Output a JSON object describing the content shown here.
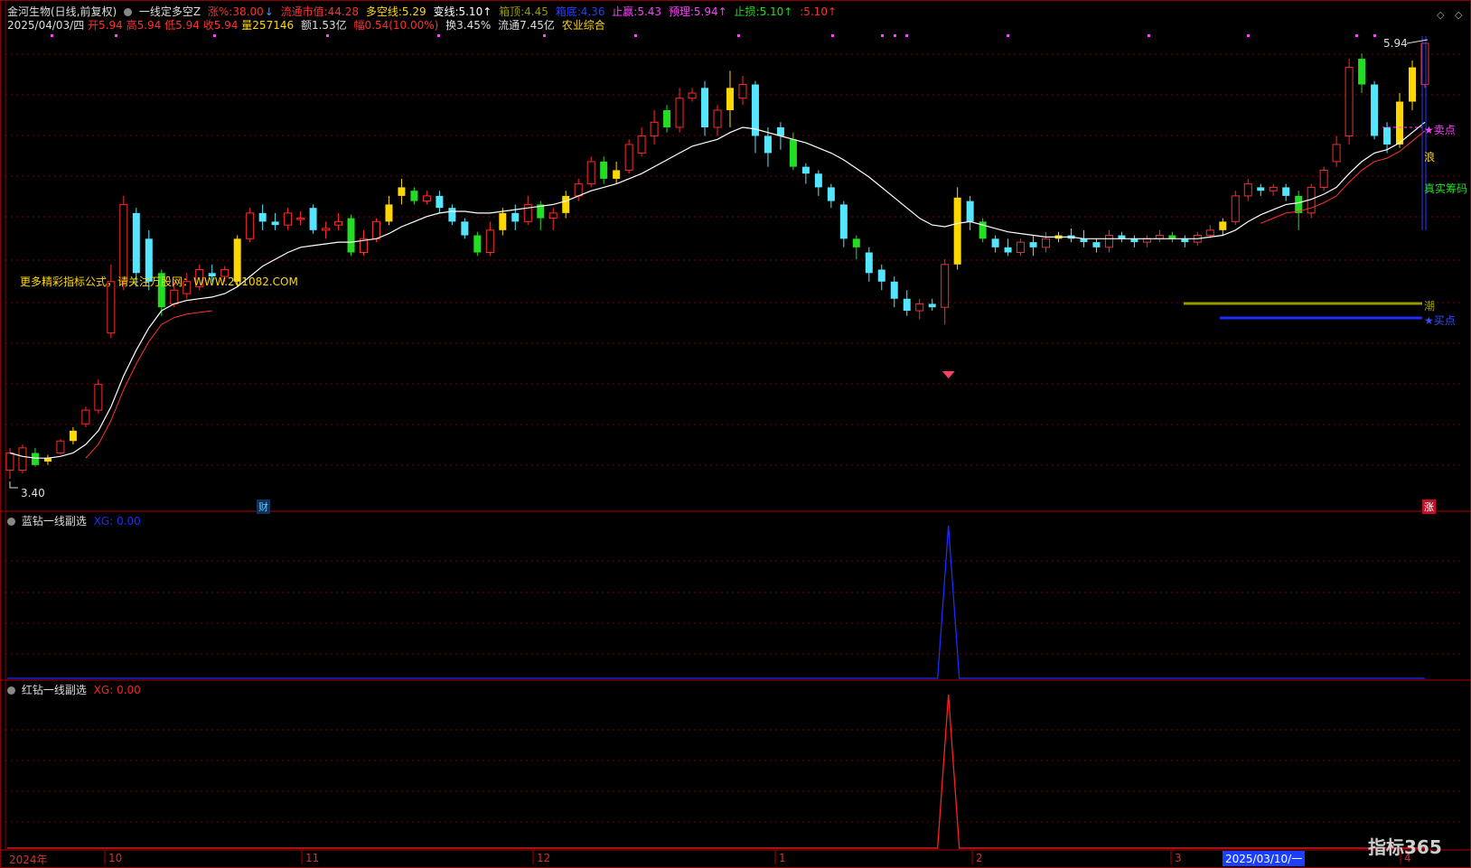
{
  "header": {
    "stock": "金河生物(日线,前复权)",
    "formula": "一线定多空Z",
    "chg_label": "涨%:",
    "chg_value": "38.00",
    "chg_arrow": "↓",
    "mv_label": "流通市值:",
    "mv_value": "44.28",
    "dk_label": "多空线:",
    "dk_value": "5.29",
    "bx_label": "变线:",
    "bx_value": "5.10↑",
    "xd_label": "箱顶:",
    "xd_value": "4.45",
    "xdi_label": "箱底:",
    "xdi_value": "4.36",
    "zy_label": "止赢:",
    "zy_value": "5.43",
    "yl_label": "预理:",
    "yl_value": "5.94↑",
    "zs_label": "止损:",
    "zs_value": "5.10↑",
    "extra": ":5.10↑"
  },
  "line2": {
    "date": "2025/04/03/四",
    "open": "开5.94",
    "high": "高5.94",
    "low": "低5.94",
    "close": "收5.94",
    "vol": "量257146",
    "amt": "额1.53亿",
    "range": "幅0.54(10.00%)",
    "turnover": "换3.45%",
    "float": "流通7.45亿",
    "industry": "农业综合"
  },
  "ad_text": "更多精彩指标公式，请关注万股网：WWW.201082.COM",
  "markers": {
    "fin": "财",
    "zhang": "涨",
    "sell": "★卖点",
    "buy": "★买点",
    "lang": "浪",
    "real": "真实筹码",
    "chao": "潮",
    "price_high": "5.94",
    "price_low": "3.40"
  },
  "indicators": {
    "blue": {
      "name": "蓝钻一线副选",
      "label": "XG:",
      "value": "0.00",
      "color": "#1a2cff"
    },
    "red": {
      "name": "红钻一线副选",
      "label": "XG:",
      "value": "0.00",
      "color": "#ff2020"
    }
  },
  "x_axis": {
    "labels": [
      "2024年",
      "10",
      "11",
      "12",
      "1",
      "2",
      "3",
      "4"
    ],
    "selected_date": "2025/03/10/一"
  },
  "logo": "指标365",
  "colors": {
    "up": "#ff2a2a",
    "down_cyan": "#55e6ff",
    "green": "#22dd22",
    "yellow": "#ffd700",
    "ma": "#ffffff",
    "grid": "#7a0000"
  },
  "chart_data": {
    "type": "candlestick",
    "ohlc": [
      [
        3.45,
        3.55,
        3.4,
        3.58
      ],
      [
        3.45,
        3.58,
        3.43,
        3.6
      ],
      [
        3.55,
        3.48,
        3.47,
        3.58
      ],
      [
        3.5,
        3.52,
        3.48,
        3.54
      ],
      [
        3.55,
        3.62,
        3.54,
        3.63
      ],
      [
        3.62,
        3.68,
        3.6,
        3.7
      ],
      [
        3.72,
        3.8,
        3.7,
        3.82
      ],
      [
        3.8,
        3.95,
        3.78,
        3.98
      ],
      [
        4.25,
        4.55,
        4.22,
        4.65
      ],
      [
        4.55,
        5.0,
        4.5,
        5.05
      ],
      [
        4.95,
        4.6,
        4.52,
        4.98
      ],
      [
        4.8,
        4.55,
        4.5,
        4.85
      ],
      [
        4.6,
        4.4,
        4.35,
        4.62
      ],
      [
        4.42,
        4.5,
        4.4,
        4.55
      ],
      [
        4.48,
        4.55,
        4.45,
        4.6
      ],
      [
        4.52,
        4.62,
        4.5,
        4.65
      ],
      [
        4.6,
        4.58,
        4.55,
        4.65
      ],
      [
        4.58,
        4.62,
        4.55,
        4.64
      ],
      [
        4.55,
        4.8,
        4.52,
        4.82
      ],
      [
        4.8,
        4.95,
        4.78,
        4.98
      ],
      [
        4.95,
        4.9,
        4.85,
        5.0
      ],
      [
        4.9,
        4.88,
        4.85,
        4.95
      ],
      [
        4.88,
        4.95,
        4.85,
        4.98
      ],
      [
        4.92,
        4.92,
        4.88,
        4.96
      ],
      [
        4.98,
        4.85,
        4.83,
        5.0
      ],
      [
        4.85,
        4.86,
        4.8,
        4.9
      ],
      [
        4.88,
        4.9,
        4.85,
        4.95
      ],
      [
        4.92,
        4.72,
        4.7,
        4.94
      ],
      [
        4.72,
        4.8,
        4.7,
        4.85
      ],
      [
        4.8,
        4.9,
        4.78,
        4.92
      ],
      [
        4.9,
        5.0,
        4.88,
        5.05
      ],
      [
        5.05,
        5.1,
        5.0,
        5.15
      ],
      [
        5.08,
        5.02,
        5.0,
        5.1
      ],
      [
        5.02,
        5.05,
        5.0,
        5.08
      ],
      [
        5.05,
        4.98,
        4.95,
        5.08
      ],
      [
        4.98,
        4.9,
        4.88,
        5.0
      ],
      [
        4.9,
        4.82,
        4.8,
        4.92
      ],
      [
        4.82,
        4.72,
        4.7,
        4.84
      ],
      [
        4.72,
        4.85,
        4.7,
        4.9
      ],
      [
        4.85,
        4.95,
        4.82,
        4.98
      ],
      [
        4.95,
        4.9,
        4.85,
        5.0
      ],
      [
        4.9,
        5.0,
        4.88,
        5.05
      ],
      [
        5.0,
        4.92,
        4.85,
        5.02
      ],
      [
        4.92,
        4.95,
        4.85,
        4.98
      ],
      [
        4.95,
        5.05,
        4.92,
        5.08
      ],
      [
        5.05,
        5.12,
        5.02,
        5.15
      ],
      [
        5.12,
        5.25,
        5.1,
        5.28
      ],
      [
        5.25,
        5.15,
        5.12,
        5.28
      ],
      [
        5.15,
        5.2,
        5.12,
        5.25
      ],
      [
        5.2,
        5.35,
        5.18,
        5.38
      ],
      [
        5.3,
        5.4,
        5.28,
        5.45
      ],
      [
        5.4,
        5.48,
        5.35,
        5.55
      ],
      [
        5.55,
        5.45,
        5.42,
        5.58
      ],
      [
        5.45,
        5.62,
        5.42,
        5.68
      ],
      [
        5.62,
        5.65,
        5.6,
        5.68
      ],
      [
        5.68,
        5.45,
        5.4,
        5.72
      ],
      [
        5.45,
        5.55,
        5.4,
        5.58
      ],
      [
        5.55,
        5.68,
        5.45,
        5.78
      ],
      [
        5.62,
        5.7,
        5.58,
        5.75
      ],
      [
        5.7,
        5.4,
        5.3,
        5.72
      ],
      [
        5.4,
        5.3,
        5.22,
        5.45
      ],
      [
        5.45,
        5.4,
        5.32,
        5.48
      ],
      [
        5.38,
        5.22,
        5.2,
        5.42
      ],
      [
        5.22,
        5.18,
        5.12,
        5.24
      ],
      [
        5.18,
        5.1,
        5.05,
        5.2
      ],
      [
        5.1,
        5.02,
        4.98,
        5.12
      ],
      [
        5.0,
        4.8,
        4.75,
        5.02
      ],
      [
        4.8,
        4.75,
        4.68,
        4.82
      ],
      [
        4.72,
        4.6,
        4.55,
        4.75
      ],
      [
        4.62,
        4.55,
        4.5,
        4.65
      ],
      [
        4.55,
        4.45,
        4.4,
        4.58
      ],
      [
        4.45,
        4.38,
        4.35,
        4.5
      ],
      [
        4.38,
        4.42,
        4.33,
        4.45
      ],
      [
        4.42,
        4.4,
        4.38,
        4.45
      ],
      [
        4.4,
        4.65,
        4.3,
        4.68
      ],
      [
        4.65,
        5.04,
        4.62,
        5.1
      ],
      [
        5.02,
        4.9,
        4.85,
        5.05
      ],
      [
        4.9,
        4.8,
        4.78,
        4.92
      ],
      [
        4.8,
        4.75,
        4.72,
        4.82
      ],
      [
        4.75,
        4.72,
        4.7,
        4.8
      ],
      [
        4.72,
        4.78,
        4.7,
        4.8
      ],
      [
        4.78,
        4.75,
        4.7,
        4.82
      ],
      [
        4.75,
        4.8,
        4.72,
        4.84
      ],
      [
        4.8,
        4.82,
        4.78,
        4.84
      ],
      [
        4.82,
        4.8,
        4.78,
        4.86
      ],
      [
        4.8,
        4.78,
        4.75,
        4.85
      ],
      [
        4.78,
        4.75,
        4.72,
        4.8
      ],
      [
        4.75,
        4.82,
        4.72,
        4.85
      ],
      [
        4.82,
        4.8,
        4.78,
        4.84
      ],
      [
        4.8,
        4.78,
        4.75,
        4.82
      ],
      [
        4.78,
        4.8,
        4.75,
        4.82
      ],
      [
        4.8,
        4.82,
        4.78,
        4.85
      ],
      [
        4.82,
        4.8,
        4.78,
        4.84
      ],
      [
        4.8,
        4.78,
        4.75,
        4.82
      ],
      [
        4.78,
        4.82,
        4.76,
        4.84
      ],
      [
        4.82,
        4.85,
        4.8,
        4.88
      ],
      [
        4.85,
        4.9,
        4.82,
        4.92
      ],
      [
        4.9,
        5.05,
        4.88,
        5.08
      ],
      [
        5.05,
        5.12,
        5.02,
        5.15
      ],
      [
        5.1,
        5.08,
        5.05,
        5.12
      ],
      [
        5.08,
        5.1,
        5.05,
        5.12
      ],
      [
        5.1,
        5.05,
        5.02,
        5.12
      ],
      [
        5.05,
        4.95,
        4.85,
        5.08
      ],
      [
        4.95,
        5.1,
        4.92,
        5.12
      ],
      [
        5.1,
        5.2,
        5.08,
        5.22
      ],
      [
        5.25,
        5.35,
        5.22,
        5.4
      ],
      [
        5.4,
        5.8,
        5.35,
        5.85
      ],
      [
        5.85,
        5.7,
        5.65,
        5.88
      ],
      [
        5.7,
        5.4,
        5.38,
        5.72
      ],
      [
        5.45,
        5.35,
        5.3,
        5.48
      ],
      [
        5.35,
        5.6,
        5.33,
        5.65
      ],
      [
        5.6,
        5.8,
        5.55,
        5.84
      ],
      [
        5.7,
        5.94,
        5.68,
        5.94
      ]
    ],
    "ma_line": [
      3.55,
      3.53,
      3.52,
      3.52,
      3.53,
      3.55,
      3.6,
      3.68,
      3.82,
      4.0,
      4.15,
      4.28,
      4.38,
      4.42,
      4.44,
      4.45,
      4.46,
      4.48,
      4.52,
      4.58,
      4.64,
      4.68,
      4.72,
      4.75,
      4.76,
      4.77,
      4.78,
      4.78,
      4.79,
      4.8,
      4.83,
      4.87,
      4.9,
      4.93,
      4.95,
      4.96,
      4.96,
      4.95,
      4.95,
      4.96,
      4.97,
      4.98,
      4.99,
      5.0,
      5.02,
      5.05,
      5.08,
      5.1,
      5.12,
      5.15,
      5.18,
      5.22,
      5.26,
      5.3,
      5.34,
      5.36,
      5.38,
      5.42,
      5.45,
      5.44,
      5.42,
      5.4,
      5.38,
      5.36,
      5.33,
      5.3,
      5.26,
      5.21,
      5.16,
      5.1,
      5.04,
      4.98,
      4.92,
      4.88,
      4.87,
      4.89,
      4.9,
      4.88,
      4.86,
      4.84,
      4.83,
      4.82,
      4.81,
      4.81,
      4.81,
      4.8,
      4.8,
      4.8,
      4.8,
      4.8,
      4.8,
      4.8,
      4.8,
      4.8,
      4.8,
      4.81,
      4.82,
      4.85,
      4.9,
      4.94,
      4.97,
      5.0,
      5.01,
      5.03,
      5.06,
      5.1,
      5.18,
      5.25,
      5.3,
      5.32,
      5.36,
      5.42,
      5.48
    ],
    "price_range": [
      3.4,
      5.94
    ],
    "indicator_blue_spike_index": 74,
    "indicator_red_spike_index": 74
  }
}
